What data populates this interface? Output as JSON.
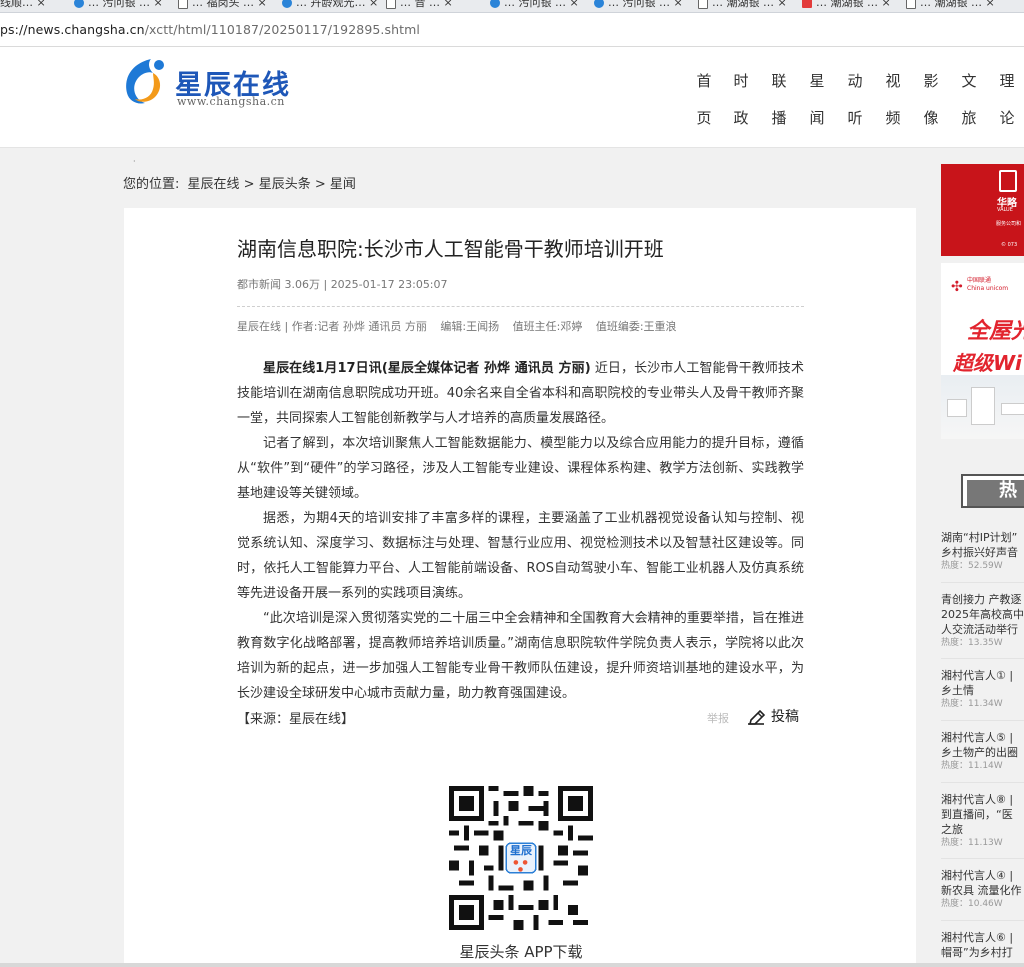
{
  "browser": {
    "tabs": [
      {
        "label": "…回线顺… ×",
        "icon": "doc"
      },
      {
        "label": "… 污问银 … ×",
        "icon": "web"
      },
      {
        "label": "… 福岗头 … ×",
        "icon": "doc"
      },
      {
        "label": "… 卉龄观光… ×",
        "icon": "web"
      },
      {
        "label": "… 音 … ×",
        "icon": "doc"
      },
      {
        "label": "… 污问银 … ×",
        "icon": "web"
      },
      {
        "label": "… 污问银 … ×",
        "icon": "web"
      },
      {
        "label": "… 潮湖银 … ×",
        "icon": "doc"
      },
      {
        "label": "… 潮湖银 … ×",
        "icon": "red"
      },
      {
        "label": "… 潮湖银 … ×",
        "icon": "doc"
      }
    ],
    "url_prefix": "ps://news.changsha.cn",
    "url_path": "/xctt/html/110187/20250117/192895.shtml"
  },
  "site": {
    "logo_text": "星辰在线",
    "logo_url": "www.changsha.cn",
    "nav": [
      {
        "line1": "首",
        "line2": "页"
      },
      {
        "line1": "时",
        "line2": "政"
      },
      {
        "line1": "联",
        "line2": "播"
      },
      {
        "line1": "星",
        "line2": "闻"
      },
      {
        "line1": "动",
        "line2": "听"
      },
      {
        "line1": "视",
        "line2": "频"
      },
      {
        "line1": "影",
        "line2": "像"
      },
      {
        "line1": "文",
        "line2": "旅"
      },
      {
        "line1": "理",
        "line2": "论"
      }
    ]
  },
  "breadcrumb": {
    "label": "您的位置:",
    "trail": "星辰在线 > 星辰头条 > 星闻"
  },
  "article": {
    "title": "湖南信息职院:长沙市人工智能骨干教师培训开班",
    "meta": "都市新闻 3.06万 | 2025-01-17 23:05:07",
    "credits": {
      "source_author": "星辰在线 | 作者:记者 孙烨 通讯员 方丽",
      "editor": "编辑:王闻扬",
      "duty_director": "值班主任:邓婷",
      "duty_editor": "值班编委:王重浪"
    },
    "lead_bold": "星辰在线1月17日讯(星辰全媒体记者 孙烨 通讯员 方丽)",
    "p1_rest": " 近日，长沙市人工智能骨干教师技术技能培训在湖南信息职院成功开班。40余名来自全省本科和高职院校的专业带头人及骨干教师齐聚一堂，共同探索人工智能创新教学与人才培养的高质量发展路径。",
    "p2": "记者了解到，本次培训聚焦人工智能数据能力、模型能力以及综合应用能力的提升目标，遵循从“软件”到“硬件”的学习路径，涉及人工智能专业建设、课程体系构建、教学方法创新、实践教学基地建设等关键领域。",
    "p3": "据悉，为期4天的培训安排了丰富多样的课程，主要涵盖了工业机器视觉设备认知与控制、视觉系统认知、深度学习、数据标注与处理、智慧行业应用、视觉检测技术以及智慧社区建设等。同时，依托人工智能算力平台、人工智能前端设备、ROS自动驾驶小车、智能工业机器人及仿真系统等先进设备开展一系列的实践项目演练。",
    "p4": "“此次培训是深入贯彻落实党的二十届三中全会精神和全国教育大会精神的重要举措，旨在推进教育数字化战略部署，提高教师培养培训质量。”湖南信息职院软件学院负责人表示，学院将以此次培训为新的起点，进一步加强人工智能专业骨干教师队伍建设，提升师资培训基地的建设水平，为长沙建设全球研发中心城市贡献力量，助力教育强国建设。",
    "source": "【来源：星辰在线】",
    "report_label": "举报",
    "submit_label": "投稿",
    "qr_badge": "星辰",
    "qr_caption": "星辰头条  APP下载"
  },
  "sidebar": {
    "ad1": {
      "brand": "华略",
      "line1": "VALUE",
      "line2": "服务公司和",
      "line3": "© 073"
    },
    "ad2": {
      "brand_cn": "中国联通",
      "brand_en": "China unicom",
      "headline1": "全屋光",
      "headline2": "超级Wi"
    },
    "hot_label": "热",
    "hot_items": [
      {
        "title": "湖南“村IP计划”\n乡村振兴好声音",
        "heat": "热度：52.59W"
      },
      {
        "title": "青创接力 产教逐\n2025年高校高中\n人交流活动举行",
        "heat": "热度：13.35W"
      },
      {
        "title": "湘村代言人① | \n乡土情",
        "heat": "热度：11.34W"
      },
      {
        "title": "湘村代言人⑤ | \n乡土物产的出圈",
        "heat": "热度：11.14W"
      },
      {
        "title": "湘村代言人⑧ | \n到直播间，“医\n之旅",
        "heat": "热度：11.13W"
      },
      {
        "title": "湘村代言人④ | \n新农具 流量化作",
        "heat": "热度：10.46W"
      },
      {
        "title": "湘村代言人⑥ | \n帽哥”为乡村打",
        "heat": ""
      }
    ]
  }
}
